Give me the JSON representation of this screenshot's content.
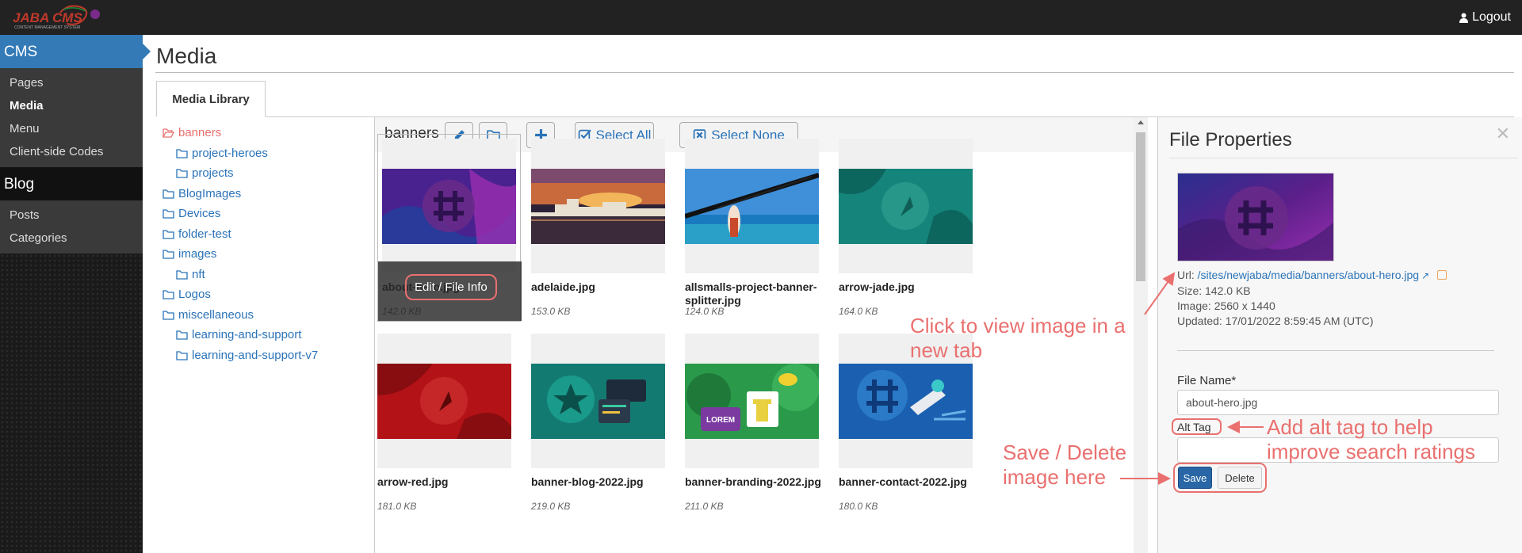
{
  "header": {
    "logo_text": "JABA CMS",
    "logo_tagline": "CONTENT MANAGEMENT SYSTEM",
    "logout_label": "Logout"
  },
  "sidebar": {
    "cms_heading": "CMS",
    "cms_items": [
      {
        "label": "Pages",
        "active": false
      },
      {
        "label": "Media",
        "active": true
      },
      {
        "label": "Menu",
        "active": false
      },
      {
        "label": "Client-side Codes",
        "active": false
      }
    ],
    "blog_heading": "Blog",
    "blog_items": [
      {
        "label": "Posts"
      },
      {
        "label": "Categories"
      }
    ]
  },
  "page": {
    "title": "Media",
    "tab_label": "Media Library"
  },
  "folders": [
    {
      "label": "banners",
      "level": 0,
      "current": true
    },
    {
      "label": "project-heroes",
      "level": 1
    },
    {
      "label": "projects",
      "level": 1
    },
    {
      "label": "BlogImages",
      "level": 0
    },
    {
      "label": "Devices",
      "level": 0
    },
    {
      "label": "folder-test",
      "level": 0
    },
    {
      "label": "images",
      "level": 0
    },
    {
      "label": "nft",
      "level": 1
    },
    {
      "label": "Logos",
      "level": 0
    },
    {
      "label": "miscellaneous",
      "level": 0
    },
    {
      "label": "learning-and-support",
      "level": 1
    },
    {
      "label": "learning-and-support-v7",
      "level": 1
    }
  ],
  "toolbar": {
    "folder_name": "banners",
    "select_all_label": "Select All",
    "select_none_label": "Select None"
  },
  "files": [
    {
      "name": "about-hero.jpg",
      "size": "142.0 KB"
    },
    {
      "name": "adelaide.jpg",
      "size": "153.0 KB"
    },
    {
      "name": "allsmalls-project-banner-splitter.jpg",
      "size": "124.0 KB"
    },
    {
      "name": "arrow-jade.jpg",
      "size": "164.0 KB"
    },
    {
      "name": "arrow-red.jpg",
      "size": "181.0 KB"
    },
    {
      "name": "banner-blog-2022.jpg",
      "size": "219.0 KB"
    },
    {
      "name": "banner-branding-2022.jpg",
      "size": "211.0 KB"
    },
    {
      "name": "banner-contact-2022.jpg",
      "size": "180.0 KB"
    }
  ],
  "hover_tile": {
    "edit_label": "Edit / File Info"
  },
  "properties": {
    "title": "File Properties",
    "url_label": "Url:",
    "url_value": "/sites/newjaba/media/banners/about-hero.jpg",
    "size_text": "Size: 142.0 KB",
    "image_text": "Image: 2560 x 1440",
    "updated_text": "Updated: 17/01/2022 8:59:45 AM (UTC)",
    "file_name_label": "File Name*",
    "file_name_value": "about-hero.jpg",
    "alt_tag_label": "Alt Tag",
    "alt_tag_value": "",
    "save_label": "Save",
    "delete_label": "Delete"
  },
  "annotations": {
    "view_image_line1": "Click to view image in a",
    "view_image_line2": "new tab",
    "alt_tag_line1": "Add alt tag to help",
    "alt_tag_line2": "improve search ratings",
    "save_delete_line1": "Save / Delete",
    "save_delete_line2": "image here"
  },
  "colors": {
    "sidebar_active": "#337ab7",
    "link": "#2a73b8",
    "annotation": "#e9706f",
    "save_button": "#2866a6"
  }
}
